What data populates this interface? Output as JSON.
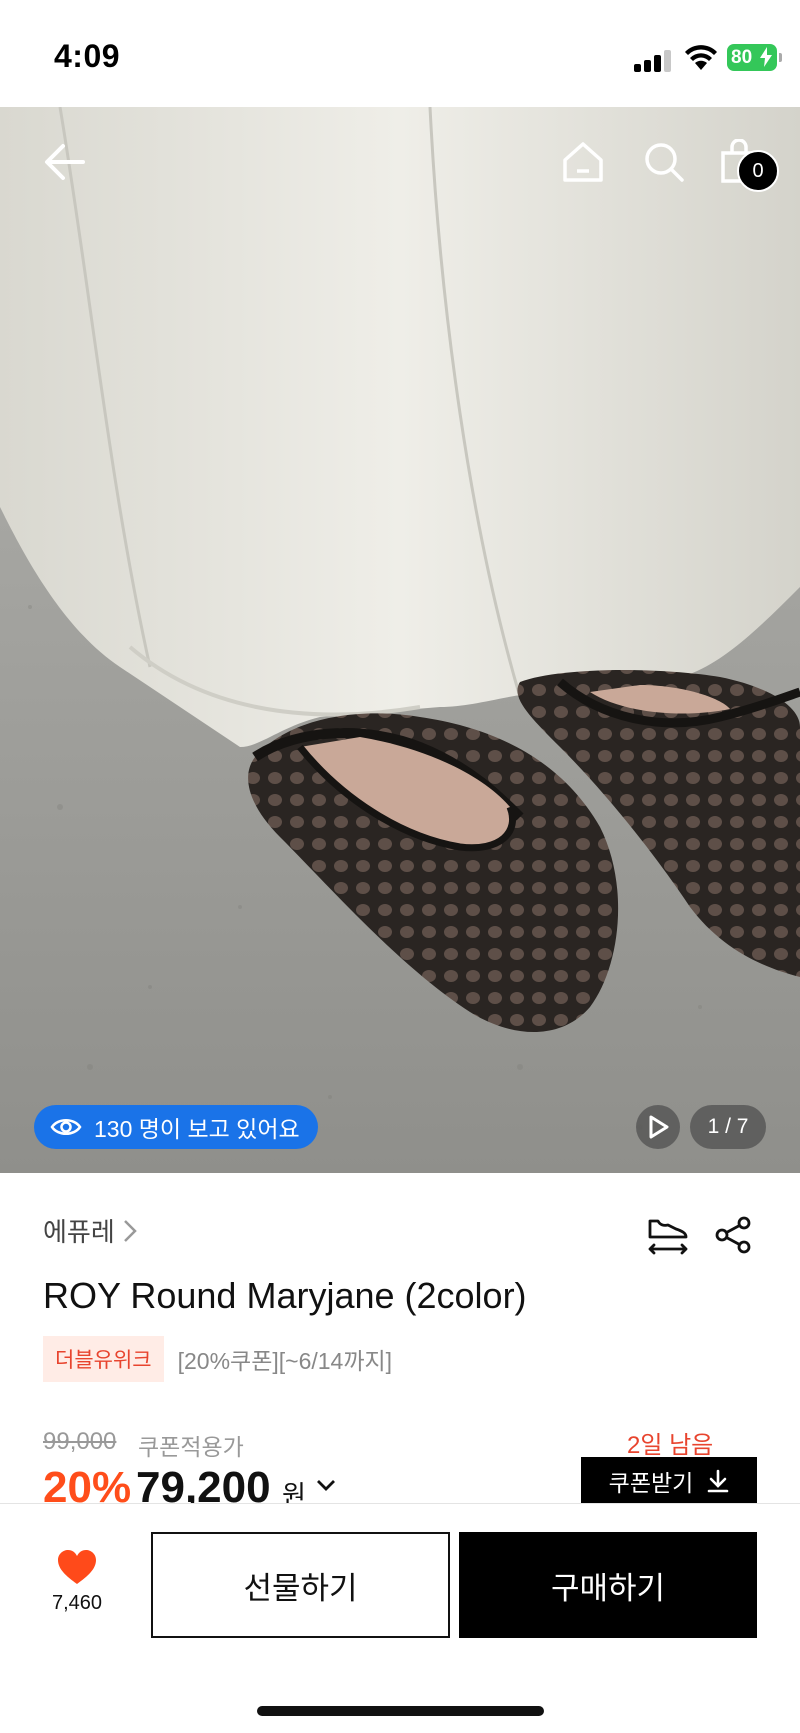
{
  "status_bar": {
    "time": "4:09",
    "battery": "80"
  },
  "header": {
    "back_icon": "arrow-left-icon",
    "home_icon": "home-icon",
    "search_icon": "search-icon",
    "cart_icon": "shopping-bag-icon",
    "cart_count": "0"
  },
  "hero": {
    "viewers_text": "130 명이 보고 있어요",
    "page_indicator": "1 / 7",
    "image_description_colors": {
      "pants": "#e9e8e1",
      "shoe": "#1a1a1a",
      "floor": "#9c9c98"
    }
  },
  "product": {
    "brand": "에퓨레",
    "title": "ROY Round Maryjane (2color)",
    "promo_badge": "더블유위크",
    "promo_text": "[20%쿠폰][~6/14까지]",
    "original_price": "99,000",
    "coupon_price_label": "쿠폰적용가",
    "days_left": "2일 남음",
    "discount": "20%",
    "price": "79,200",
    "currency": "원",
    "coupon_button": "쿠폰받기"
  },
  "bottom_bar": {
    "like_count": "7,460",
    "gift_button": "선물하기",
    "buy_button": "구매하기"
  },
  "colors": {
    "accent_orange": "#ff4d1a",
    "badge_red": "#e8442e",
    "viewer_blue": "#1a73e8",
    "like_red": "#ff4a1a"
  }
}
